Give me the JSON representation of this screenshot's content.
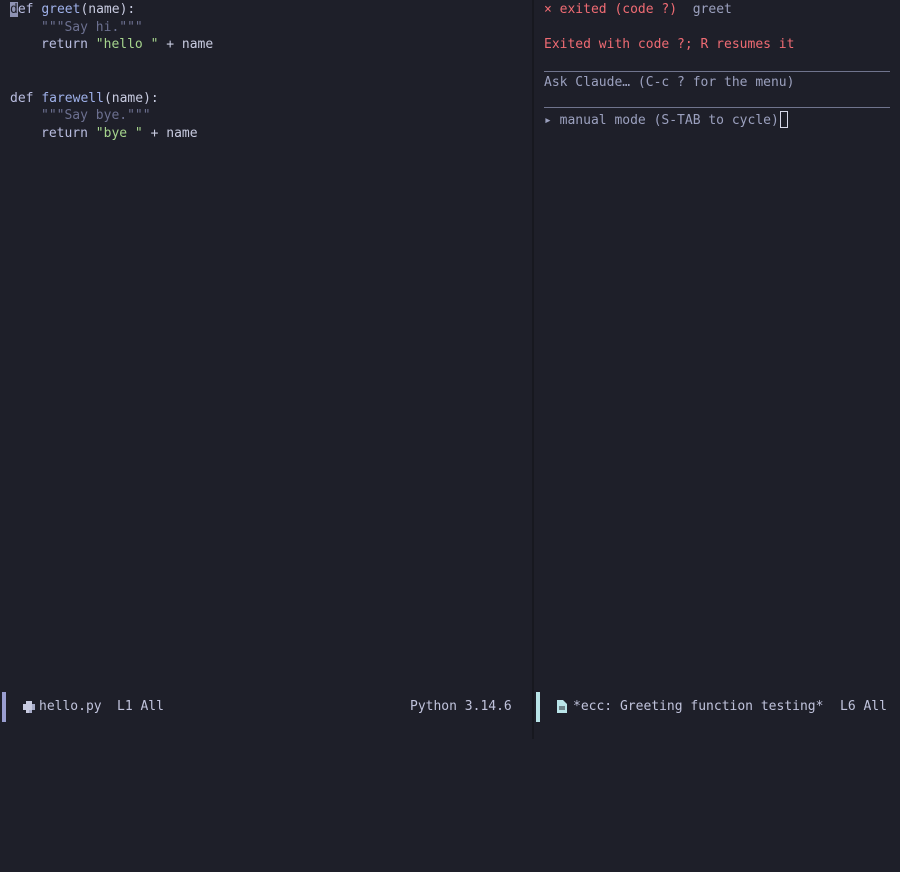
{
  "editor": {
    "lines": [
      {
        "def": "def",
        "name": "greet",
        "args": "(name):"
      },
      {
        "doc": "\"\"\"Say hi.\"\"\""
      },
      {
        "ret": "return",
        "str": "\"hello \"",
        "rest": " + name"
      },
      {
        "def": "def",
        "name": "farewell",
        "args": "(name):"
      },
      {
        "doc": "\"\"\"Say bye.\"\"\""
      },
      {
        "ret": "return",
        "str": "\"bye \"",
        "rest": " + name"
      }
    ]
  },
  "agent": {
    "header_status": "× exited (code ?)",
    "header_name": "greet",
    "exit_message": "Exited with code ?; R resumes it",
    "prompt_placeholder": "Ask Claude… (C-c ? for the menu)",
    "mode_indicator": "▸ manual mode (S-TAB to cycle)"
  },
  "modeline_left": {
    "filename": "hello.py",
    "position": "L1 All",
    "mode": "Python 3.14.6",
    "bar_color": "#9a9ed0",
    "icon": "python-icon"
  },
  "modeline_right": {
    "buffer": "*ecc: Greeting function testing*",
    "position": "L6 All",
    "bar_color": "#b9e4e8",
    "icon": "file-icon"
  }
}
